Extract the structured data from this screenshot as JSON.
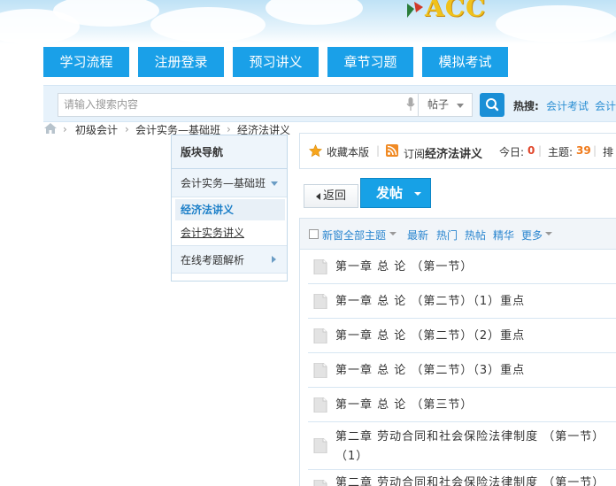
{
  "header": {
    "logo_text": "ACC"
  },
  "nav": {
    "items": [
      {
        "label": "学习流程"
      },
      {
        "label": "注册登录"
      },
      {
        "label": "预习讲义"
      },
      {
        "label": "章节习题"
      },
      {
        "label": "模拟考试"
      }
    ]
  },
  "search": {
    "placeholder": "请输入搜索内容",
    "category": "帖子",
    "hot_label": "热搜:",
    "hot_links": [
      "会计考试",
      "会计"
    ]
  },
  "breadcrumb": {
    "items": [
      "初级会计",
      "会计实务—基础班",
      "经济法讲义"
    ]
  },
  "board_nav": {
    "title": "版块导航",
    "group1": "会计实务—基础班",
    "items": [
      "经济法讲义",
      "会计实务讲义"
    ],
    "group2": "在线考题解析"
  },
  "forum": {
    "favorite": "收藏本版",
    "subscribe_prefix": "订阅",
    "forum_name": "经济法讲义",
    "today_label": "今日:",
    "today_count": "0",
    "topics_label": "主题:",
    "topics_count": "39",
    "rank_label": "排"
  },
  "actions": {
    "back": "返回",
    "post": "发帖"
  },
  "filter": {
    "new_window": "新窗",
    "all_topics": "全部主题",
    "links": [
      "最新",
      "热门",
      "热帖",
      "精华",
      "更多"
    ]
  },
  "threads": [
    {
      "title": "第一章 总 论 （第一节）"
    },
    {
      "title": "第一章 总 论 （第二节）（1）重点"
    },
    {
      "title": "第一章 总 论 （第二节）（2）重点"
    },
    {
      "title": "第一章 总 论 （第二节）（3）重点"
    },
    {
      "title": "第一章 总 论 （第三节）"
    },
    {
      "title": "第二章 劳动合同和社会保险法律制度 （第一节）（1）"
    },
    {
      "title": "第二章 劳动合同和社会保险法律制度 （第一节）"
    }
  ],
  "colors": {
    "nav_blue": "#1aa0e8",
    "link_blue": "#2b86cf",
    "count_red": "#e0452a",
    "count_orange": "#f07a1a"
  }
}
